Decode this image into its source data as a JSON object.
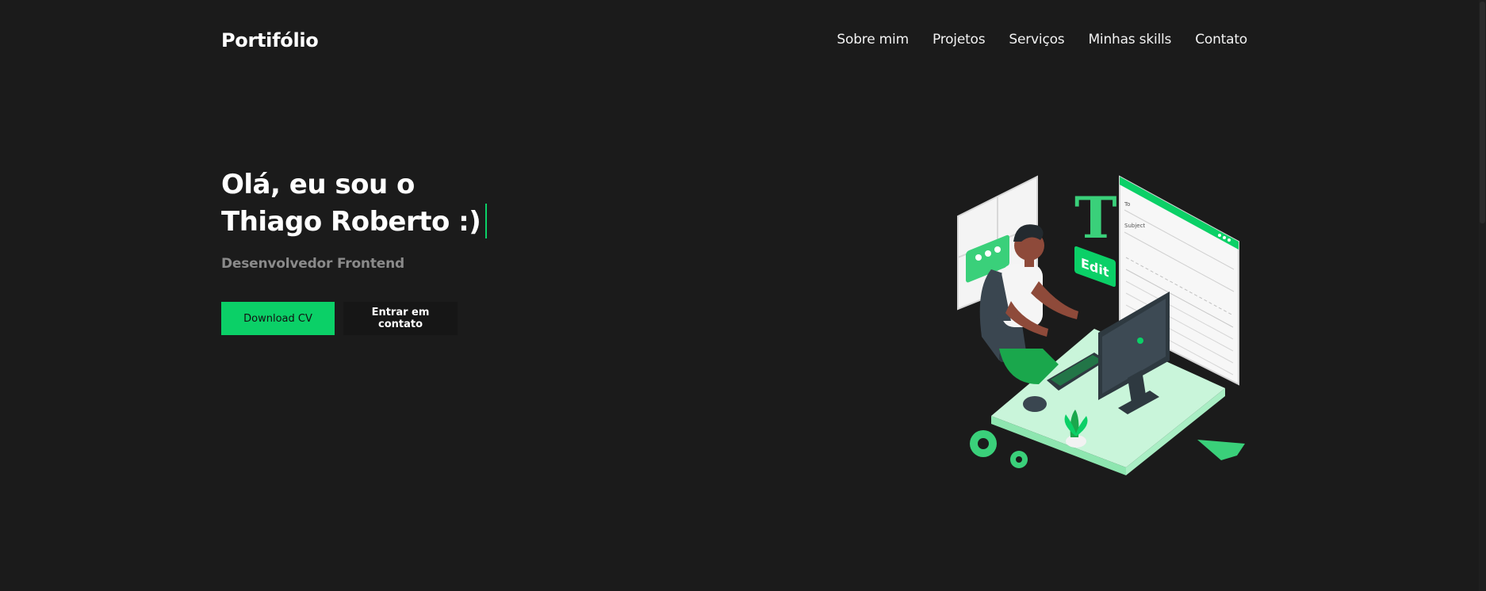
{
  "header": {
    "logo": "Portifólio",
    "nav": [
      {
        "label": "Sobre mim"
      },
      {
        "label": "Projetos"
      },
      {
        "label": "Serviços"
      },
      {
        "label": "Minhas skills"
      },
      {
        "label": "Contato"
      }
    ]
  },
  "hero": {
    "title_line1": "Olá, eu sou o",
    "title_line2": "Thiago Roberto :)",
    "subtitle": "Desenvolvedor Frontend",
    "primary_button": "Download CV",
    "secondary_button": "Entrar em contato"
  },
  "illustration": {
    "badge_text": "Edit",
    "letter": "T",
    "form_labels": [
      "To",
      "Subject"
    ]
  },
  "colors": {
    "background": "#1b1b1b",
    "accent": "#0bd067",
    "text": "#f2f2f2",
    "muted": "#8a8a8a"
  }
}
